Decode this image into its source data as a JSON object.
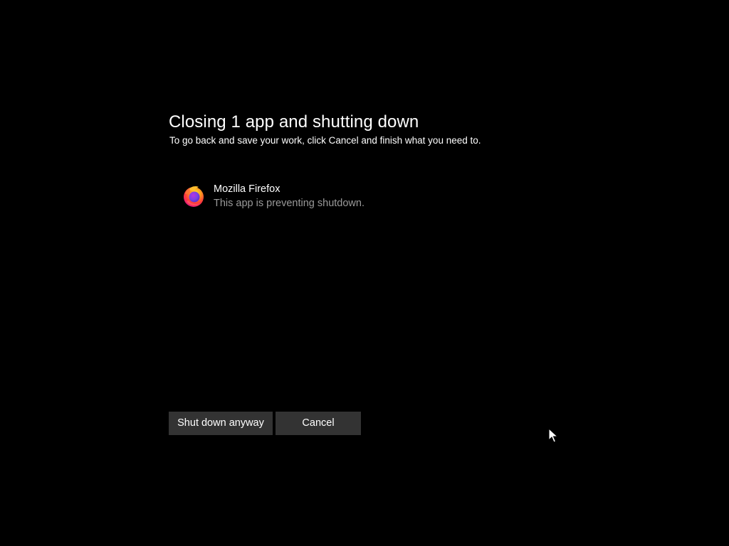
{
  "dialog": {
    "title": "Closing 1 app and shutting down",
    "subtitle": "To go back and save your work, click Cancel and finish what you need to."
  },
  "apps": [
    {
      "name": "Mozilla Firefox",
      "status": "This app is preventing shutdown.",
      "icon": "firefox-icon"
    }
  ],
  "buttons": {
    "shutdown_label": "Shut down anyway",
    "cancel_label": "Cancel"
  },
  "colors": {
    "background": "#000000",
    "text_primary": "#ffffff",
    "text_secondary": "#9a9a9a",
    "button_bg": "#333333"
  },
  "cursor": {
    "icon": "mouse-pointer-icon"
  }
}
